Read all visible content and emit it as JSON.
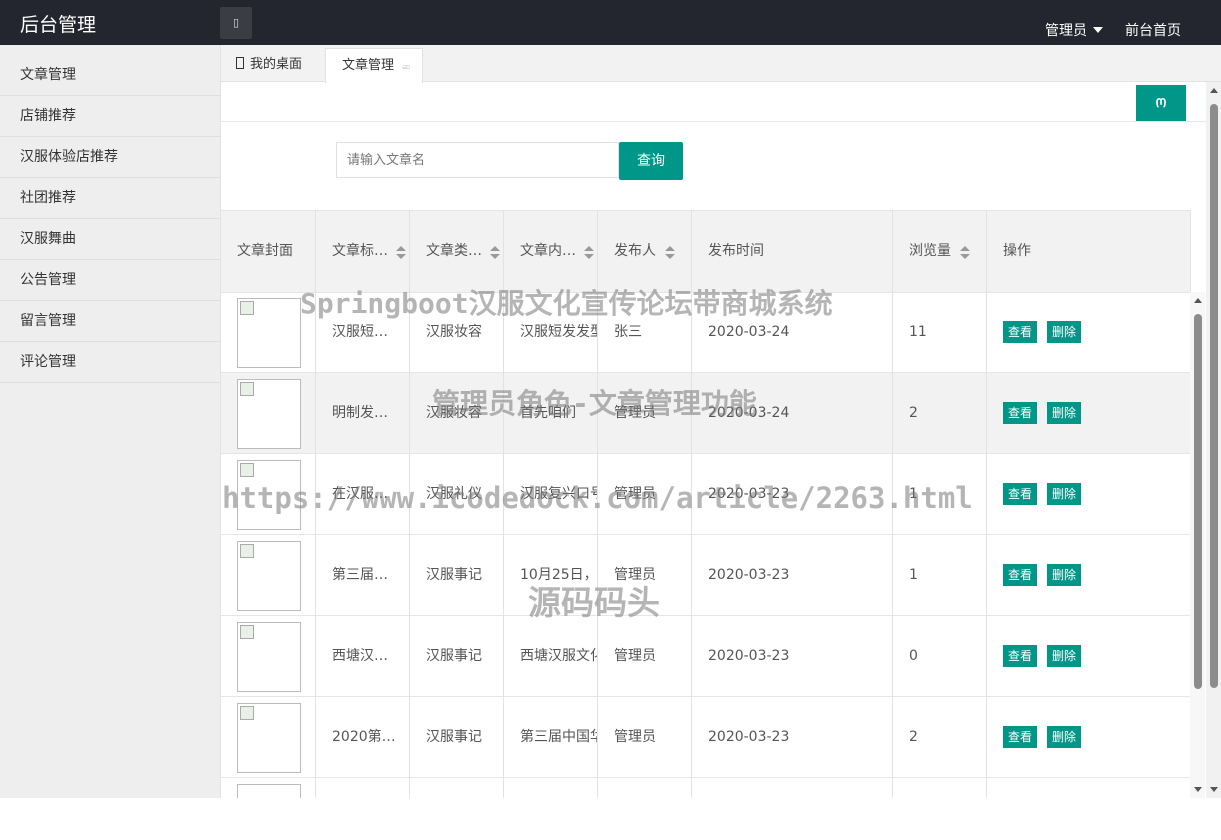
{
  "header": {
    "logo": "后台管理",
    "toggle_icon": "menu-toggle-icon",
    "admin_label": "管理员",
    "home_link": "前台首页"
  },
  "sidebar": {
    "items": [
      {
        "label": "文章管理"
      },
      {
        "label": "店铺推荐"
      },
      {
        "label": "汉服体验店推荐"
      },
      {
        "label": "社团推荐"
      },
      {
        "label": "汉服舞曲"
      },
      {
        "label": "公告管理"
      },
      {
        "label": "留言管理"
      },
      {
        "label": "评论管理"
      }
    ]
  },
  "tabs": {
    "home_label": "我的桌面",
    "active_label": "文章管理",
    "close_icon": "ဆ"
  },
  "toolbar": {
    "refresh_icon": "Ო"
  },
  "search": {
    "placeholder": "请输入文章名",
    "button_label": "查询"
  },
  "table": {
    "headers": [
      "文章封面",
      "文章标…",
      "文章类…",
      "文章内…",
      "发布人",
      "发布时间",
      "浏览量",
      "操作"
    ],
    "view_label": "查看",
    "delete_label": "删除",
    "rows": [
      {
        "title": "汉服短…",
        "category": "汉服妆容",
        "content": "汉服短发发型",
        "author": "张三",
        "date": "2020-03-24",
        "views": "11"
      },
      {
        "title": "明制发…",
        "category": "汉服妆容",
        "content": "首先咱们",
        "author": "管理员",
        "date": "2020-03-24",
        "views": "2"
      },
      {
        "title": "在汉服…",
        "category": "汉服礼仪",
        "content": "汉服复兴口号",
        "author": "管理员",
        "date": "2020-03-23",
        "views": "1"
      },
      {
        "title": "第三届…",
        "category": "汉服事记",
        "content": "10月25日，",
        "author": "管理员",
        "date": "2020-03-23",
        "views": "1"
      },
      {
        "title": "西塘汉…",
        "category": "汉服事记",
        "content": "西塘汉服文化",
        "author": "管理员",
        "date": "2020-03-23",
        "views": "0"
      },
      {
        "title": "2020第…",
        "category": "汉服事记",
        "content": "第三届中国华",
        "author": "管理员",
        "date": "2020-03-23",
        "views": "2"
      }
    ]
  },
  "watermark": {
    "line1": "Springboot汉服文化宣传论坛带商城系统",
    "line2": "管理员角色-文章管理功能",
    "line3": "https://www.icodedock.com/article/2263.html",
    "line4": "源码码头"
  }
}
